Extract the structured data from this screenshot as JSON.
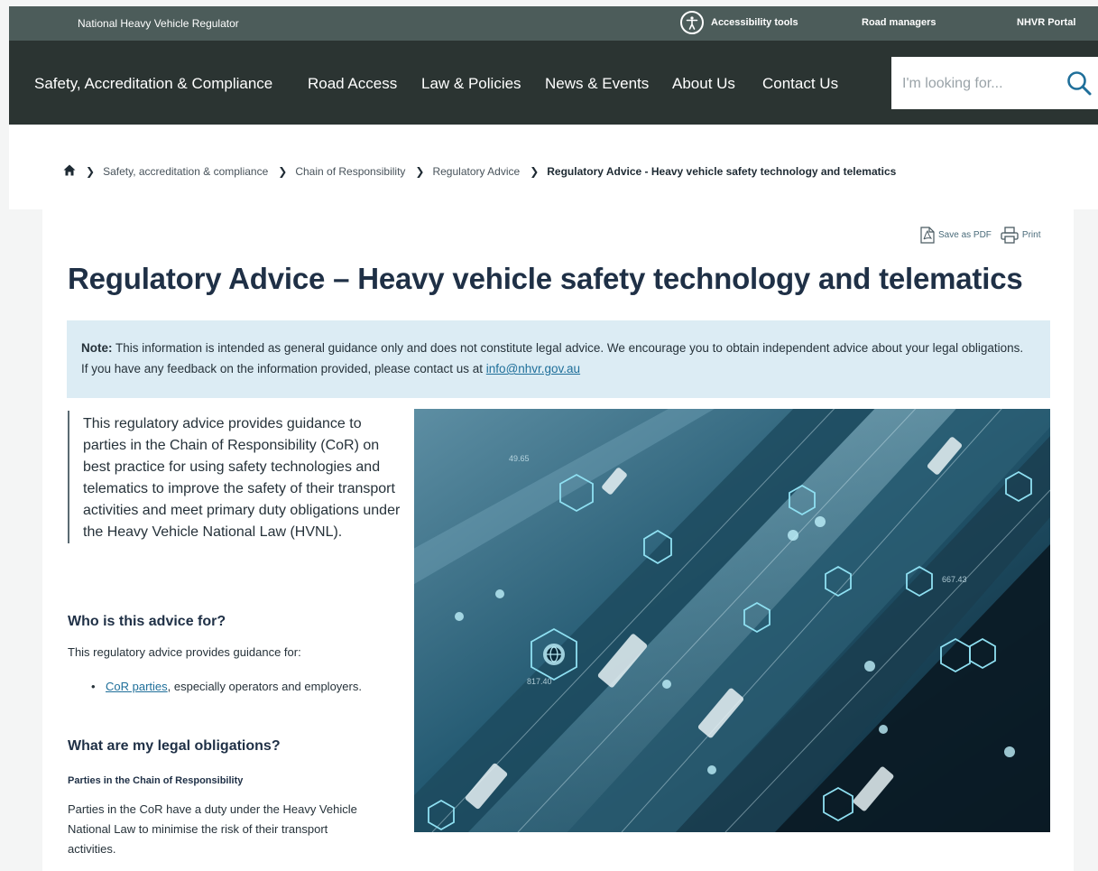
{
  "topbar": {
    "brand": "National Heavy Vehicle Regulator",
    "accessibility": "Accessibility tools",
    "road_managers": "Road managers",
    "portal": "NHVR Portal"
  },
  "nav": {
    "items": [
      "Safety, Accreditation & Compliance",
      "Road Access",
      "Law & Policies",
      "News & Events",
      "About Us",
      "Contact Us"
    ],
    "search_placeholder": "I'm looking for..."
  },
  "breadcrumb": {
    "items": [
      "Safety, accreditation & compliance",
      "Chain of Responsibility",
      "Regulatory Advice"
    ],
    "current": "Regulatory Advice - Heavy vehicle safety technology and telematics"
  },
  "tools": {
    "pdf": "Save as PDF",
    "print": "Print"
  },
  "page": {
    "title": "Regulatory Advice – Heavy vehicle safety technology and telematics",
    "note_label": "Note:",
    "note_text": " This information is intended as general guidance only and does not constitute legal advice. We encourage you to obtain independent advice about your legal obligations. If you have any feedback on the information provided, please contact us at ",
    "note_email": "info@nhvr.gov.au",
    "lead": "This regulatory advice provides guidance to parties in the Chain of Responsibility (CoR) on best practice for using safety technologies and telematics to improve the safety of their transport activities and meet primary duty obligations under the Heavy Vehicle National Law (HVNL).",
    "who_heading": "Who is this advice for?",
    "who_text": "This regulatory advice provides guidance for:",
    "bullet_link": "CoR parties",
    "bullet_rest": ", especially operators and employers.",
    "obligations_heading": "What are my legal obligations?",
    "parties_heading": "Parties in the Chain of Responsibility",
    "parties_text": "Parties in the CoR have a duty under the Heavy Vehicle National Law to minimise the risk of their transport activities."
  },
  "hero_overlay": {
    "label_a": "667.43",
    "label_b": "817.40",
    "label_c": "49.65"
  },
  "colors": {
    "topbar": "#4c5c5a",
    "nav": "#2b3432",
    "title": "#1f3046",
    "note_bg": "#dcecf4",
    "link": "#1f6f9a",
    "search_icon": "#1f6f9a"
  },
  "icons": [
    "accessibility-icon",
    "search-icon",
    "home-icon",
    "chevron-right-icon",
    "pdf-icon",
    "print-icon"
  ]
}
